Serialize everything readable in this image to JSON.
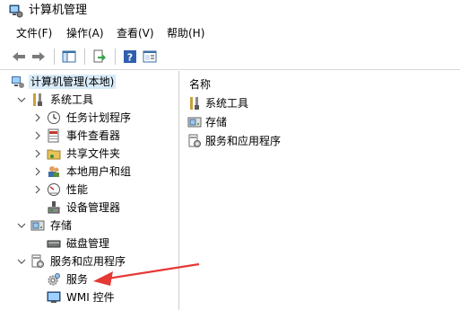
{
  "window": {
    "title": "计算机管理",
    "icon": "computer-management-icon"
  },
  "menu": [
    {
      "label": "文件(F)"
    },
    {
      "label": "操作(A)"
    },
    {
      "label": "查看(V)"
    },
    {
      "label": "帮助(H)"
    }
  ],
  "toolbar": {
    "buttons": [
      "back-arrow-icon",
      "forward-arrow-icon",
      "show-hide-tree-icon",
      "export-list-icon",
      "help-icon",
      "properties-view-icon"
    ]
  },
  "tree": {
    "root": {
      "label": "计算机管理(本地)",
      "icon": "computer-management-icon"
    },
    "system_tools": {
      "label": "系统工具",
      "icon": "tools-icon",
      "children": [
        {
          "label": "任务计划程序",
          "icon": "clock-icon"
        },
        {
          "label": "事件查看器",
          "icon": "event-viewer-icon"
        },
        {
          "label": "共享文件夹",
          "icon": "shared-folder-icon"
        },
        {
          "label": "本地用户和组",
          "icon": "users-icon"
        },
        {
          "label": "性能",
          "icon": "performance-icon"
        },
        {
          "label": "设备管理器",
          "icon": "device-manager-icon"
        }
      ]
    },
    "storage": {
      "label": "存储",
      "icon": "storage-icon",
      "children": [
        {
          "label": "磁盘管理",
          "icon": "disk-icon"
        }
      ]
    },
    "services_apps": {
      "label": "服务和应用程序",
      "icon": "services-apps-icon",
      "children": [
        {
          "label": "服务",
          "icon": "gear-icon"
        },
        {
          "label": "WMI 控件",
          "icon": "wmi-icon"
        }
      ]
    }
  },
  "content": {
    "column_header": "名称",
    "items": [
      {
        "label": "系统工具",
        "icon": "tools-icon"
      },
      {
        "label": "存储",
        "icon": "storage-icon"
      },
      {
        "label": "服务和应用程序",
        "icon": "services-apps-icon"
      }
    ]
  },
  "annotation": {
    "color": "#e53935"
  }
}
